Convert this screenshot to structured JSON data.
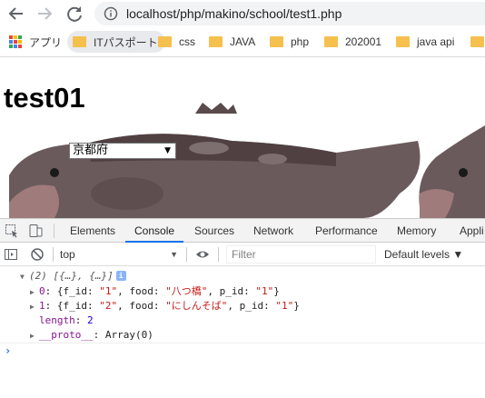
{
  "address_bar": {
    "url": "localhost/php/makino/school/test1.php"
  },
  "bookmarks": [
    {
      "label": "アプリ",
      "icon": "apps-grid-icon"
    },
    {
      "label": "ITパスポート",
      "icon": "folder-icon"
    },
    {
      "label": "css",
      "icon": "folder-icon"
    },
    {
      "label": "JAVA",
      "icon": "folder-icon"
    },
    {
      "label": "php",
      "icon": "folder-icon"
    },
    {
      "label": "202001",
      "icon": "folder-icon"
    },
    {
      "label": "java api",
      "icon": "folder-icon"
    }
  ],
  "page": {
    "title": "test01",
    "prefecture_select": "京都府",
    "background_image": "fish-illustration"
  },
  "devtools": {
    "tabs": [
      "Elements",
      "Console",
      "Sources",
      "Network",
      "Performance",
      "Memory",
      "Appli"
    ],
    "active_tab": "Console",
    "toolbar": {
      "context": "top",
      "filter_placeholder": "Filter",
      "levels": "Default levels ▼"
    },
    "console": {
      "summary": "(2) [{…}, {…}]",
      "info_badge": "i",
      "rows": [
        {
          "index": "0",
          "f_id": "\"1\"",
          "food": "\"八つ橋\"",
          "p_id": "\"1\""
        },
        {
          "index": "1",
          "f_id": "\"2\"",
          "food": "\"にしんそば\"",
          "p_id": "\"1\""
        }
      ],
      "labels": {
        "f_id": "f_id",
        "food": "food",
        "p_id": "p_id",
        "length_key": "length",
        "length_value": "2",
        "proto_key": "__proto__",
        "proto_value": "Array(0)"
      },
      "prompt": "›"
    }
  },
  "colors": {
    "active_tab_underline": "#1a73e8",
    "string_value": "#c41a16",
    "number_value": "#1c00cf",
    "key": "#881391",
    "folder": "#f5c04e"
  }
}
